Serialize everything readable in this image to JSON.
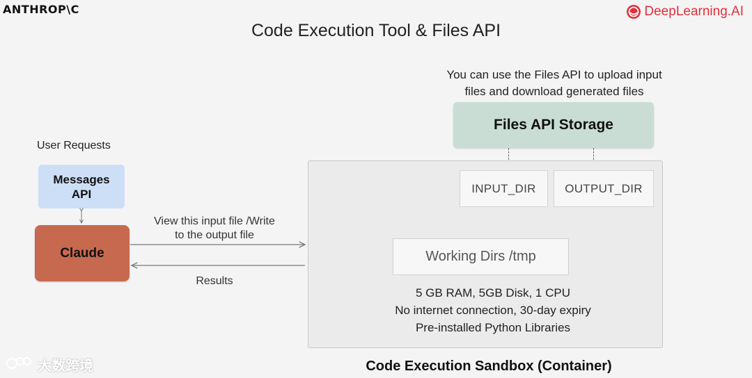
{
  "header": {
    "brand_left": "ANTHROP\\C",
    "brand_right": "DeepLearning.AI",
    "title": "Code Execution Tool & Files API"
  },
  "files_api": {
    "note_line1": "You can use the Files API to upload input",
    "note_line2": "files and download generated files",
    "storage_label": "Files API Storage"
  },
  "sandbox": {
    "input_dir": "INPUT_DIR",
    "output_dir": "OUTPUT_DIR",
    "working_dirs": "Working Dirs /tmp",
    "specs": [
      "5 GB RAM, 5GB Disk, 1 CPU",
      "No internet connection, 30-day expiry",
      "Pre-installed Python Libraries"
    ],
    "label": "Code Execution Sandbox (Container)"
  },
  "client": {
    "user_requests": "User Requests",
    "messages_line1": "Messages",
    "messages_line2": "API",
    "claude": "Claude"
  },
  "arrows": {
    "request_line1": "View this input file /Write",
    "request_line2": "to the output file",
    "results": "Results"
  },
  "watermark": {
    "text": "大数跨境"
  },
  "colors": {
    "storage": "#c9ddd4",
    "messages": "#cddff7",
    "claude": "#c7694f",
    "brand_red": "#e0303a"
  },
  "icons": {
    "brand_logo": "deeplearning-logo-icon",
    "watermark_logo": "watermark-logo-icon"
  }
}
